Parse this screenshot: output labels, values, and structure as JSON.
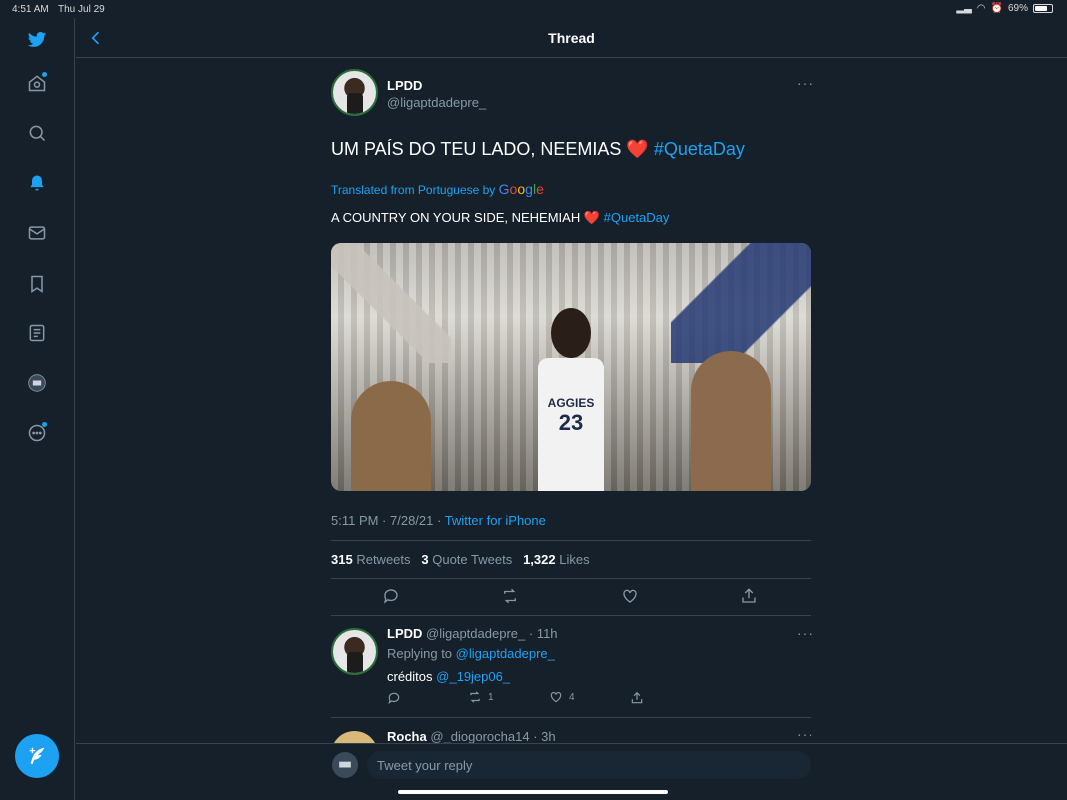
{
  "status": {
    "time": "4:51 AM",
    "date": "Thu Jul 29",
    "battery": "69%"
  },
  "header": {
    "title": "Thread"
  },
  "tweet": {
    "name": "LPDD",
    "handle": "@ligaptdadepre_",
    "text": "UM PAÍS DO TEU LADO, NEEMIAS ❤️ ",
    "hashtag": "#QuetaDay",
    "translated_label": "Translated from Portuguese by",
    "translated_brand": "Google",
    "translation_text": "A COUNTRY ON YOUR SIDE, NEHEMIAH ❤️",
    "translation_hashtag": "#QuetaDay",
    "photo": {
      "jersey_text": "AGGIES",
      "jersey_number": "23"
    },
    "timestamp": "5:11 PM · 7/28/21 · ",
    "source": "Twitter for iPhone",
    "retweets_count": "315",
    "retweets_label": "Retweets",
    "quotes_count": "3",
    "quotes_label": "Quote Tweets",
    "likes_count": "1,322",
    "likes_label": "Likes"
  },
  "replies": [
    {
      "name": "LPDD",
      "handle": "@ligaptdadepre_",
      "time": "· 11h",
      "replying_label": "Replying to",
      "replying_to": "@ligaptdadepre_",
      "text": "créditos",
      "mention": "@_19jep06_",
      "retweets": "1",
      "likes": "4"
    },
    {
      "name": "Rocha",
      "handle": "@_diogorocha14",
      "time": "· 3h"
    }
  ],
  "reply_bar": {
    "placeholder": "Tweet your reply"
  },
  "colors": {
    "background": "#15202b",
    "accent": "#1da1f2",
    "muted": "#8899a6",
    "border": "#38444d"
  }
}
